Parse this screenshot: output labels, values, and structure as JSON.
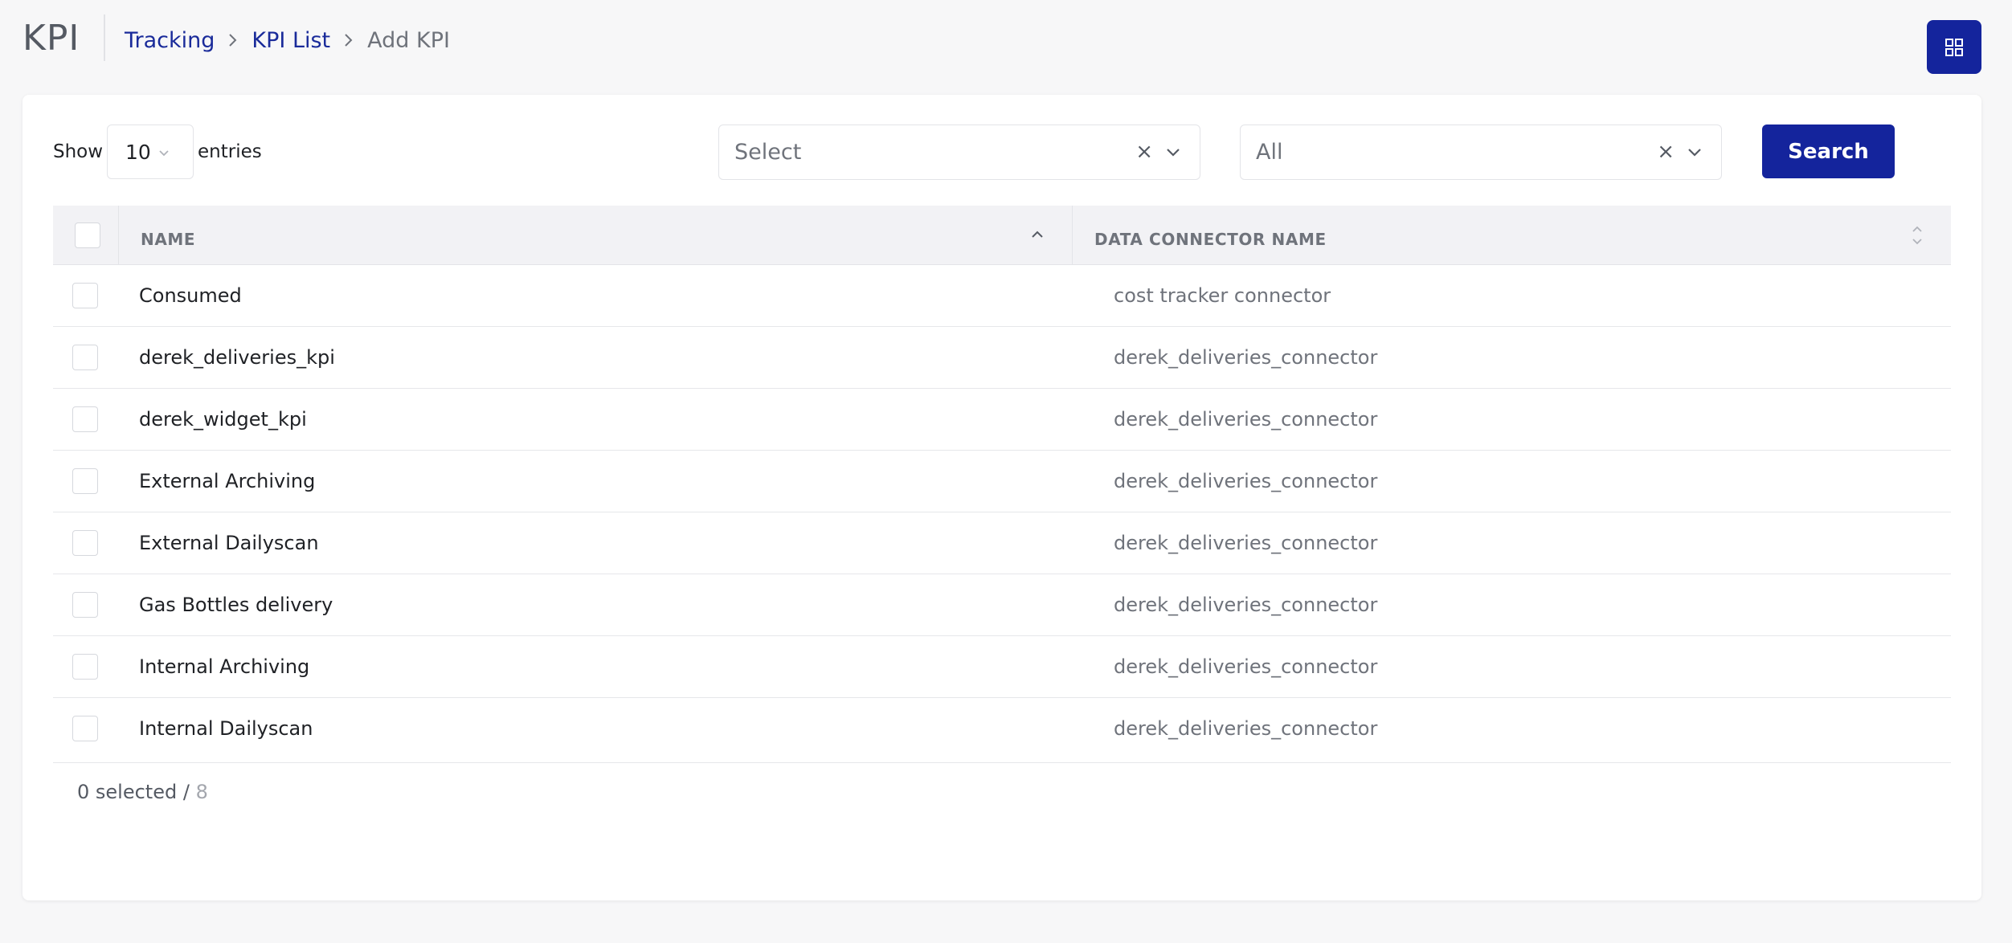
{
  "header": {
    "app_title": "KPI",
    "breadcrumb": {
      "tracking": "Tracking",
      "kpi_list": "KPI List",
      "current": "Add KPI"
    }
  },
  "controls": {
    "show_label": "Show",
    "entries_value": "10",
    "entries_label": "entries",
    "filter1": {
      "placeholder": "Select",
      "clear": "×"
    },
    "filter2": {
      "value": "All",
      "clear": "×"
    },
    "search_label": "Search"
  },
  "table": {
    "columns": {
      "name": "NAME",
      "connector": "DATA CONNECTOR NAME"
    },
    "rows": [
      {
        "name": "Consumed",
        "connector": "cost tracker connector"
      },
      {
        "name": "derek_deliveries_kpi",
        "connector": "derek_deliveries_connector"
      },
      {
        "name": "derek_widget_kpi",
        "connector": "derek_deliveries_connector"
      },
      {
        "name": "External Archiving",
        "connector": "derek_deliveries_connector"
      },
      {
        "name": "External Dailyscan",
        "connector": "derek_deliveries_connector"
      },
      {
        "name": "Gas Bottles delivery",
        "connector": "derek_deliveries_connector"
      },
      {
        "name": "Internal Archiving",
        "connector": "derek_deliveries_connector"
      },
      {
        "name": "Internal Dailyscan",
        "connector": "derek_deliveries_connector"
      }
    ]
  },
  "footer": {
    "selected": "0 selected / ",
    "total": "8"
  },
  "colors": {
    "accent": "#14249c",
    "link": "#1a2b9a",
    "header_bg": "#f2f2f5"
  },
  "icons": {
    "breadcrumb_separator": "chevron-right-icon",
    "app_menu": "grid-icon",
    "dropdown": "chevron-down-icon",
    "sort_ascending": "chevron-up-icon",
    "sort_unsorted": "sort-icon"
  }
}
